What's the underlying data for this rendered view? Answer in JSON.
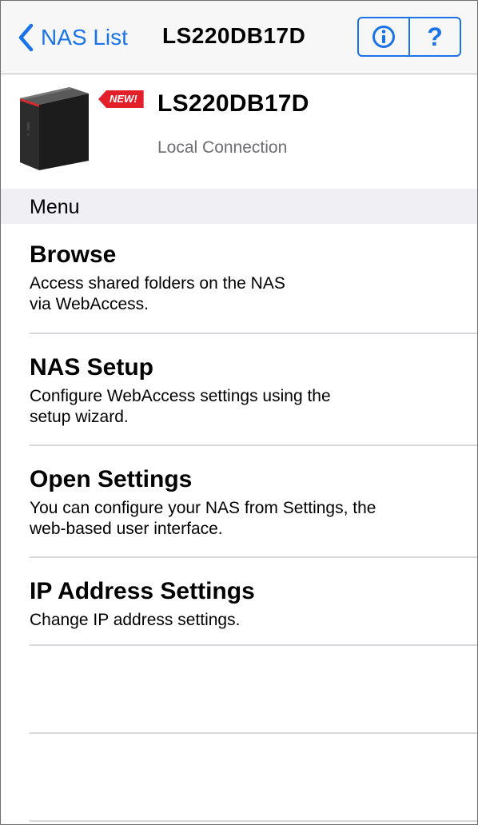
{
  "navbar": {
    "back_label": "NAS List",
    "title": "LS220DB17D",
    "info_icon": "info-circle-icon",
    "help_label": "?",
    "accent_color": "#1a73e8"
  },
  "device": {
    "badge": "NEW!",
    "name": "LS220DB17D",
    "connection": "Local Connection",
    "badge_color": "#e3202a"
  },
  "section": {
    "title": "Menu"
  },
  "menu": {
    "items": [
      {
        "title": "Browse",
        "desc_line1": "Access shared folders on the NAS",
        "desc_line2": "via WebAccess."
      },
      {
        "title": "NAS Setup",
        "desc_line1": "Configure WebAccess settings using the",
        "desc_line2": "setup wizard."
      },
      {
        "title": "Open Settings",
        "desc_line1": "You can configure your NAS from Settings, the",
        "desc_line2": "web-based user interface."
      },
      {
        "title": "IP Address Settings",
        "desc_line1": "Change IP address settings.",
        "desc_line2": ""
      }
    ]
  }
}
